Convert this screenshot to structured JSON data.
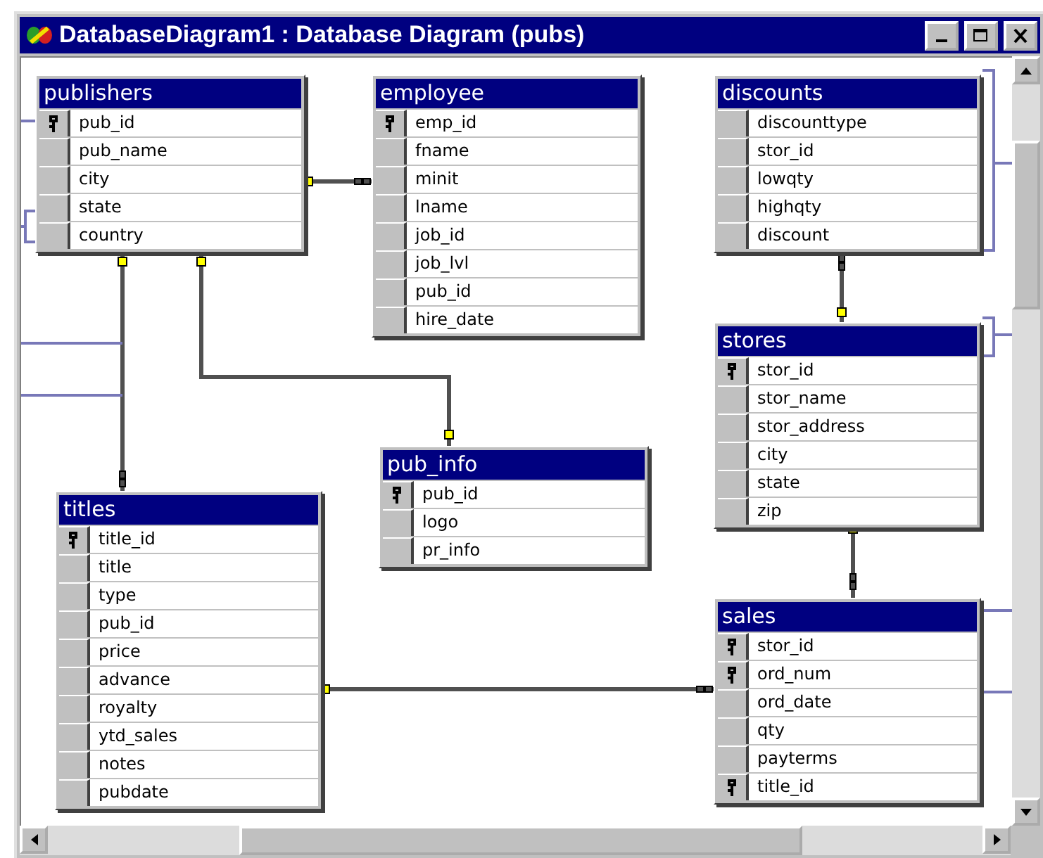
{
  "window": {
    "title": "DatabaseDiagram1 : Database Diagram (pubs)"
  },
  "tables": [
    {
      "name": "publishers",
      "columns": [
        {
          "name": "pub_id",
          "key": true
        },
        {
          "name": "pub_name",
          "key": false
        },
        {
          "name": "city",
          "key": false
        },
        {
          "name": "state",
          "key": false
        },
        {
          "name": "country",
          "key": false
        }
      ]
    },
    {
      "name": "employee",
      "columns": [
        {
          "name": "emp_id",
          "key": true
        },
        {
          "name": "fname",
          "key": false
        },
        {
          "name": "minit",
          "key": false
        },
        {
          "name": "lname",
          "key": false
        },
        {
          "name": "job_id",
          "key": false
        },
        {
          "name": "job_lvl",
          "key": false
        },
        {
          "name": "pub_id",
          "key": false
        },
        {
          "name": "hire_date",
          "key": false
        }
      ]
    },
    {
      "name": "discounts",
      "columns": [
        {
          "name": "discounttype",
          "key": false
        },
        {
          "name": "stor_id",
          "key": false
        },
        {
          "name": "lowqty",
          "key": false
        },
        {
          "name": "highqty",
          "key": false
        },
        {
          "name": "discount",
          "key": false
        }
      ]
    },
    {
      "name": "stores",
      "columns": [
        {
          "name": "stor_id",
          "key": true
        },
        {
          "name": "stor_name",
          "key": false
        },
        {
          "name": "stor_address",
          "key": false
        },
        {
          "name": "city",
          "key": false
        },
        {
          "name": "state",
          "key": false
        },
        {
          "name": "zip",
          "key": false
        }
      ]
    },
    {
      "name": "pub_info",
      "columns": [
        {
          "name": "pub_id",
          "key": true
        },
        {
          "name": "logo",
          "key": false
        },
        {
          "name": "pr_info",
          "key": false
        }
      ]
    },
    {
      "name": "titles",
      "columns": [
        {
          "name": "title_id",
          "key": true
        },
        {
          "name": "title",
          "key": false
        },
        {
          "name": "type",
          "key": false
        },
        {
          "name": "pub_id",
          "key": false
        },
        {
          "name": "price",
          "key": false
        },
        {
          "name": "advance",
          "key": false
        },
        {
          "name": "royalty",
          "key": false
        },
        {
          "name": "ytd_sales",
          "key": false
        },
        {
          "name": "notes",
          "key": false
        },
        {
          "name": "pubdate",
          "key": false
        }
      ]
    },
    {
      "name": "sales",
      "columns": [
        {
          "name": "stor_id",
          "key": true
        },
        {
          "name": "ord_num",
          "key": true
        },
        {
          "name": "ord_date",
          "key": false
        },
        {
          "name": "qty",
          "key": false
        },
        {
          "name": "payterms",
          "key": false
        },
        {
          "name": "title_id",
          "key": true
        }
      ]
    }
  ]
}
